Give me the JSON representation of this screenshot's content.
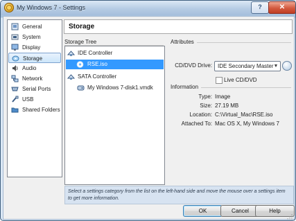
{
  "window": {
    "title": "My Windows 7 - Settings",
    "help_button": "?",
    "close_button": "✕"
  },
  "nav": {
    "items": [
      {
        "label": "General"
      },
      {
        "label": "System"
      },
      {
        "label": "Display"
      },
      {
        "label": "Storage"
      },
      {
        "label": "Audio"
      },
      {
        "label": "Network"
      },
      {
        "label": "Serial Ports"
      },
      {
        "label": "USB"
      },
      {
        "label": "Shared Folders"
      }
    ],
    "selected": "Storage"
  },
  "page": {
    "title": "Storage"
  },
  "storage_tree": {
    "label": "Storage Tree",
    "items": [
      {
        "label": "IDE Controller"
      },
      {
        "label": "RSE.iso",
        "selected": true
      },
      {
        "label": "SATA Controller"
      },
      {
        "label": "My Windows 7-disk1.vmdk"
      }
    ],
    "buttons": [
      "add-attachment",
      "remove-attachment",
      "add-controller",
      "remove-controller"
    ]
  },
  "attributes": {
    "label": "Attributes",
    "cd_dvd_drive_label": "CD/DVD Drive:",
    "cd_dvd_drive_value": "IDE Secondary Master",
    "live_cd_label": "Live CD/DVD",
    "live_cd_checked": false
  },
  "information": {
    "label": "Information",
    "type_label": "Type:",
    "type_value": "Image",
    "size_label": "Size:",
    "size_value": "27.19 MB",
    "location_label": "Location:",
    "location_value": "C:\\Virtual_Mac\\RSE.iso",
    "attached_label": "Attached To:",
    "attached_value": "Mac OS X, My Windows 7"
  },
  "hint_text": "Select a settings category from the list on the left-hand side and move the mouse over a settings item to get more information.",
  "buttons": {
    "ok": "OK",
    "cancel": "Cancel",
    "help": "Help"
  },
  "colors": {
    "selection": "#3399ff",
    "info_bg": "#d7e3f1",
    "title_bar": "#b6cce4"
  }
}
